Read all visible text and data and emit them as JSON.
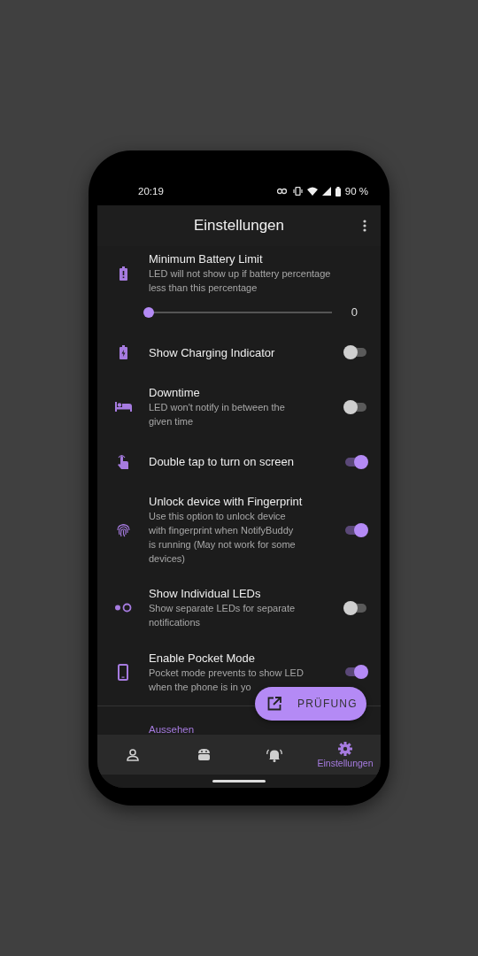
{
  "status_bar": {
    "time": "20:19",
    "battery": "90 %"
  },
  "app_bar": {
    "title": "Einstellungen"
  },
  "slider_setting": {
    "title": "Minimum Battery Limit",
    "description": "LED will not show up if battery percentage\nless than this percentage",
    "level": 0,
    "reading": "0"
  },
  "settings": [
    {
      "title": "Show Charging Indicator",
      "on": false
    },
    {
      "title": "Downtime",
      "description": "LED won't notify in between the\ngiven time",
      "on": false
    },
    {
      "title": "Double tap to turn on screen",
      "on": true
    },
    {
      "title": "Unlock device with Fingerprint",
      "description": "Use this option to unlock device\nwith fingerprint when NotifyBuddy\nis running (May not work for some\ndevices)",
      "on": true
    },
    {
      "title": "Show Individual LEDs",
      "description": "Show separate LEDs for separate\nnotifications",
      "on": false
    },
    {
      "title": "Enable Pocket Mode",
      "description": "Pocket mode prevents to show LED\nwhen the phone is in yo",
      "on": true
    }
  ],
  "section_header": "Aussehen",
  "fab": {
    "label": "PRÜFUNG"
  },
  "bottom_nav": [
    {
      "selected": false
    },
    {
      "selected": false
    },
    {
      "selected": false
    },
    {
      "label": "Einstellungen",
      "selected": true
    }
  ]
}
